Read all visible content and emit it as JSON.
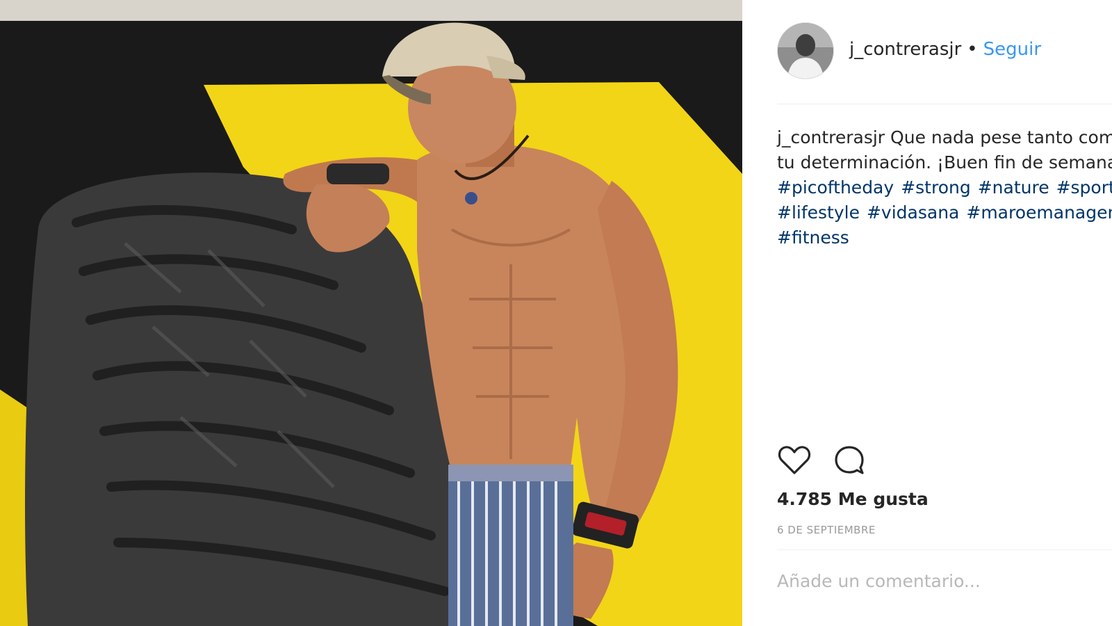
{
  "post": {
    "username": "j_contrerasjr",
    "separator": "•",
    "follow_label": "Seguir",
    "avatar_icon": "profile-photo",
    "caption": {
      "username": "j_contrerasjr",
      "line1_text": "Que nada pese tanto como",
      "line2_text": "tu determinación. ¡Buen fin de semana",
      "hashtag_lines": [
        [
          "#picoftheday",
          "#strong",
          "#nature",
          "#sport"
        ],
        [
          "#lifestyle",
          "#vidasana",
          "#maroemanagement"
        ],
        [
          "#fitness"
        ]
      ]
    },
    "actions": {
      "like_icon": "heart-icon",
      "comment_icon": "speech-bubble-icon"
    },
    "likes_text": "4.785 Me gusta",
    "date_text": "6 DE SEPTIEMBRE",
    "comment_placeholder": "Añade un comentario..."
  },
  "colors": {
    "link": "#3897f0",
    "hashtag": "#003569",
    "text": "#262626",
    "muted": "#999999",
    "wall_yellow": "#f2d516",
    "wall_black": "#1a1a1a"
  }
}
